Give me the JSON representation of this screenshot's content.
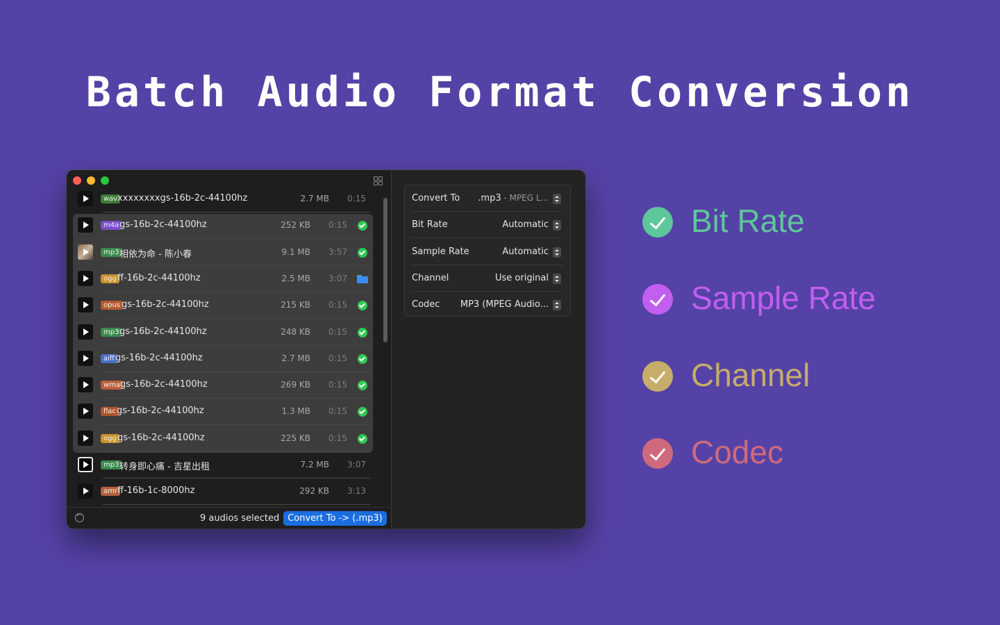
{
  "headline": "Batch Audio Format Conversion",
  "window": {
    "files": [
      {
        "format": "wav",
        "format_color": "#3f7c3a",
        "name": "xxxxxxxxgs-16b-2c-44100hz",
        "size": "2.7 MB",
        "duration": "0:15",
        "status": "none",
        "selected": false,
        "thumb": false
      },
      {
        "format": "m4a",
        "format_color": "#7b4fc9",
        "name": "gs-16b-2c-44100hz",
        "size": "252 KB",
        "duration": "0:15",
        "status": "done",
        "selected": true,
        "thumb": false
      },
      {
        "format": "mp3",
        "format_color": "#3b8a4e",
        "name": "相依为命 - 陈小春",
        "size": "9.1 MB",
        "duration": "3:57",
        "status": "done",
        "selected": true,
        "thumb": true
      },
      {
        "format": "ogg",
        "format_color": "#c7922a",
        "name": "ff-16b-2c-44100hz",
        "size": "2.5 MB",
        "duration": "3:07",
        "status": "folder",
        "selected": true,
        "thumb": false
      },
      {
        "format": "opus",
        "format_color": "#b45a2e",
        "name": "gs-16b-2c-44100hz",
        "size": "215 KB",
        "duration": "0:15",
        "status": "done",
        "selected": true,
        "thumb": false
      },
      {
        "format": "mp3",
        "format_color": "#3b8a4e",
        "name": "gs-16b-2c-44100hz",
        "size": "248 KB",
        "duration": "0:15",
        "status": "done",
        "selected": true,
        "thumb": false
      },
      {
        "format": "aiff",
        "format_color": "#4a6fc7",
        "name": "gs-16b-2c-44100hz",
        "size": "2.7 MB",
        "duration": "0:15",
        "status": "done",
        "selected": true,
        "thumb": false
      },
      {
        "format": "wma",
        "format_color": "#b8603a",
        "name": "gs-16b-2c-44100hz",
        "size": "269 KB",
        "duration": "0:15",
        "status": "done",
        "selected": true,
        "thumb": false
      },
      {
        "format": "flac",
        "format_color": "#b4532e",
        "name": "gs-16b-2c-44100hz",
        "size": "1.3 MB",
        "duration": "0:15",
        "status": "done",
        "selected": true,
        "thumb": false
      },
      {
        "format": "ogg",
        "format_color": "#c7922a",
        "name": "gs-16b-2c-44100hz",
        "size": "225 KB",
        "duration": "0:15",
        "status": "done",
        "selected": true,
        "thumb": false
      },
      {
        "format": "mp3",
        "format_color": "#3b8a4e",
        "name": "转身即心痛 - 吉星出租",
        "size": "7.2 MB",
        "duration": "3:07",
        "status": "none",
        "selected": false,
        "thumb": false,
        "outlined": true
      },
      {
        "format": "amr",
        "format_color": "#b8603a",
        "name": "ff-16b-1c-8000hz",
        "size": "292 KB",
        "duration": "3:13",
        "status": "none",
        "selected": false,
        "thumb": false
      }
    ],
    "bottom": {
      "selected_count": "9 audios selected",
      "convert_button": "Convert To -> (.mp3)"
    },
    "settings": [
      {
        "label": "Convert To",
        "value": ".mp3",
        "sub": " - MPEG L..."
      },
      {
        "label": "Bit Rate",
        "value": "Automatic",
        "sub": ""
      },
      {
        "label": "Sample Rate",
        "value": "Automatic",
        "sub": ""
      },
      {
        "label": "Channel",
        "value": "Use original",
        "sub": ""
      },
      {
        "label": "Codec",
        "value": "MP3 (MPEG Audio...",
        "sub": ""
      }
    ]
  },
  "features": [
    {
      "label": "Bit Rate",
      "color": "#5ec79a"
    },
    {
      "label": "Sample Rate",
      "color": "#c25ef0"
    },
    {
      "label": "Channel",
      "color": "#c6ad6a"
    },
    {
      "label": "Codec",
      "color": "#cf6a7e"
    }
  ]
}
